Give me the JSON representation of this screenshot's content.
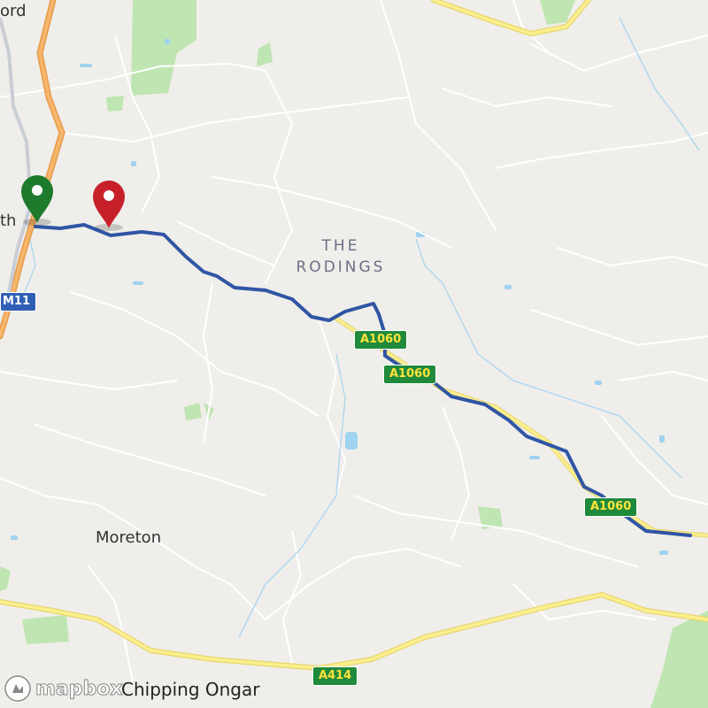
{
  "map": {
    "places": {
      "top_left_partial": "ord",
      "left_partial": "th",
      "moreton": "Moreton",
      "chipping_ongar": "Chipping Ongar"
    },
    "region": {
      "line1": "THE",
      "line2": "RODINGS"
    },
    "road_shields": {
      "m11": "M11",
      "a1060_1": "A1060",
      "a1060_2": "A1060",
      "a1060_3": "A1060",
      "a414": "A414"
    },
    "markers": {
      "start_color": "#1e7a2c",
      "end_color": "#c8202a"
    },
    "route_color": "#2f55a4",
    "attribution": {
      "logo_text": "mapbox"
    }
  }
}
